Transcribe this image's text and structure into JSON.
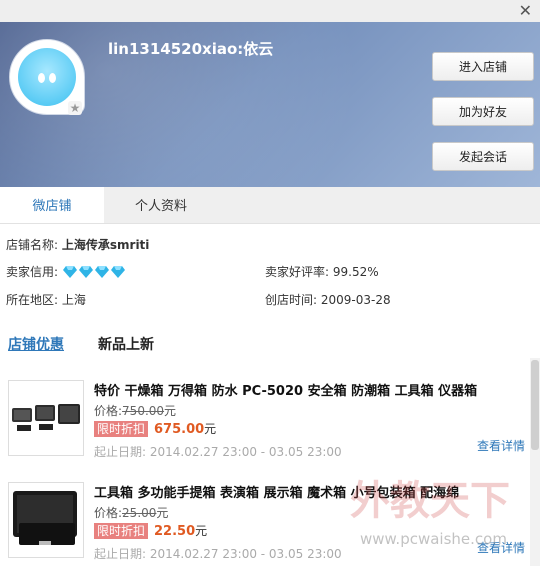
{
  "window": {
    "close_glyph": "✕"
  },
  "header": {
    "username": "lin1314520xiao:依云",
    "buttons": {
      "enter_shop": "进入店铺",
      "add_friend": "加为好友",
      "start_chat": "发起会话"
    }
  },
  "tabs": {
    "micro_shop": "微店铺",
    "profile": "个人资料"
  },
  "shop": {
    "name_label": "店铺名称:",
    "name_value": "上海传承smriti",
    "credit_label": "卖家信用:",
    "credit_diamonds": 4,
    "rating_label": "卖家好评率:",
    "rating_value": "99.52%",
    "region_label": "所在地区:",
    "region_value": "上海",
    "since_label": "创店时间:",
    "since_value": "2009-03-28"
  },
  "subtabs": {
    "discounts": "店铺优惠",
    "new_arrivals": "新品上新"
  },
  "products": [
    {
      "title": "特价 干燥箱 万得箱 防水 PC-5020 安全箱 防潮箱 工具箱 仪器箱",
      "price_label": "价格:",
      "old_price": "750.00",
      "old_unit": "元",
      "badge": "限时折扣",
      "new_price": "675.00",
      "new_unit": "元",
      "dates": "起止日期: 2014.02.27 23:00 - 03.05 23:00",
      "details": "查看详情"
    },
    {
      "title": "工具箱 多功能手提箱 表演箱 展示箱 魔术箱 小号包装箱 配海绵",
      "price_label": "价格:",
      "old_price": "25.00",
      "old_unit": "元",
      "badge": "限时折扣",
      "new_price": "22.50",
      "new_unit": "元",
      "dates": "起止日期: 2014.02.27 23:00 - 03.05 23:00",
      "details": "查看详情"
    }
  ],
  "watermark": {
    "brand": "外教天下",
    "url": "www.pcwaishe.com"
  },
  "colors": {
    "link": "#2f78b9",
    "price": "#e05a22",
    "badge": "#e8817f",
    "diamond": "#2fb4e6"
  }
}
